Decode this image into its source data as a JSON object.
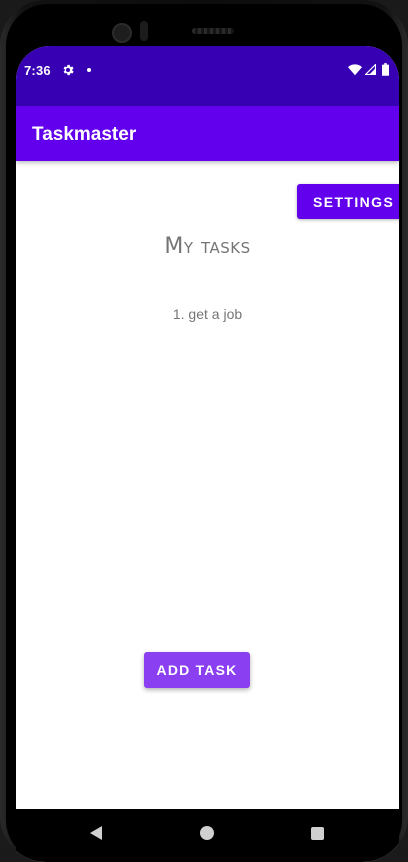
{
  "status_bar": {
    "time": "7:36",
    "icons": [
      "gear-icon",
      "dot-icon",
      "wifi-icon",
      "signal-icon",
      "battery-icon"
    ]
  },
  "app_bar": {
    "title": "Taskmaster"
  },
  "settings_button": {
    "label": "SETTINGS"
  },
  "page": {
    "title": "My tasks"
  },
  "tasks": [
    {
      "text": "1. get a job"
    }
  ],
  "add_task_button": {
    "label": "ADD TASK"
  },
  "nav_bar": {
    "icons": [
      "back-icon",
      "home-icon",
      "recents-icon"
    ]
  },
  "colors": {
    "status_bar": "#3700b3",
    "app_bar": "#6200ee",
    "settings_button": "#6200ee",
    "add_task_button": "#8a3ff0",
    "text_secondary": "#757575"
  }
}
